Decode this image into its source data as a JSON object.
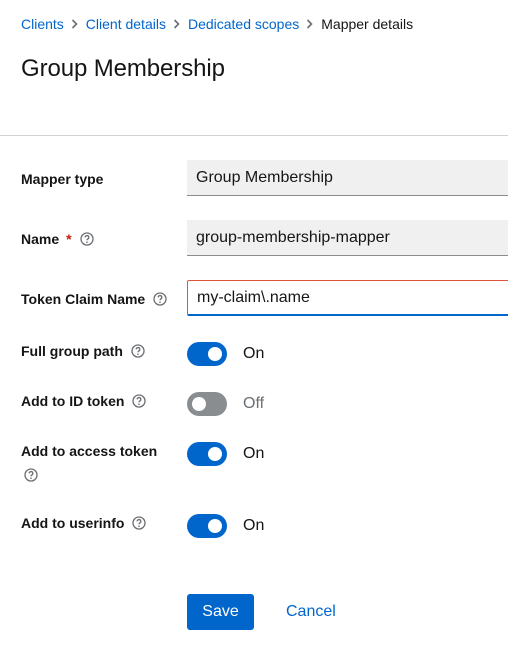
{
  "breadcrumb": {
    "items": [
      {
        "label": "Clients"
      },
      {
        "label": "Client details"
      },
      {
        "label": "Dedicated scopes"
      },
      {
        "label": "Mapper details"
      }
    ],
    "separator_icon": "chevron-right-icon"
  },
  "page": {
    "title": "Group Membership"
  },
  "form": {
    "mapper_type": {
      "label": "Mapper type",
      "value": "Group Membership"
    },
    "name": {
      "label": "Name",
      "required_mark": "*",
      "value": "group-membership-mapper",
      "help_icon": "help-icon"
    },
    "token_claim_name": {
      "label": "Token Claim Name",
      "value": "my-claim\\.name",
      "help_icon": "help-icon"
    },
    "full_group_path": {
      "label": "Full group path",
      "state_label": "On",
      "checked": true
    },
    "add_to_id_token": {
      "label": "Add to ID token",
      "state_label": "Off",
      "checked": false
    },
    "add_to_access_token": {
      "label": "Add to access token",
      "state_label": "On",
      "checked": true
    },
    "add_to_userinfo": {
      "label": "Add to userinfo",
      "state_label": "On",
      "checked": true
    }
  },
  "actions": {
    "save_label": "Save",
    "cancel_label": "Cancel"
  },
  "colors": {
    "primary": "#0066cc",
    "required": "#c9190b",
    "switch_off": "#8a8d90",
    "input_bg": "#f0f0f0"
  }
}
